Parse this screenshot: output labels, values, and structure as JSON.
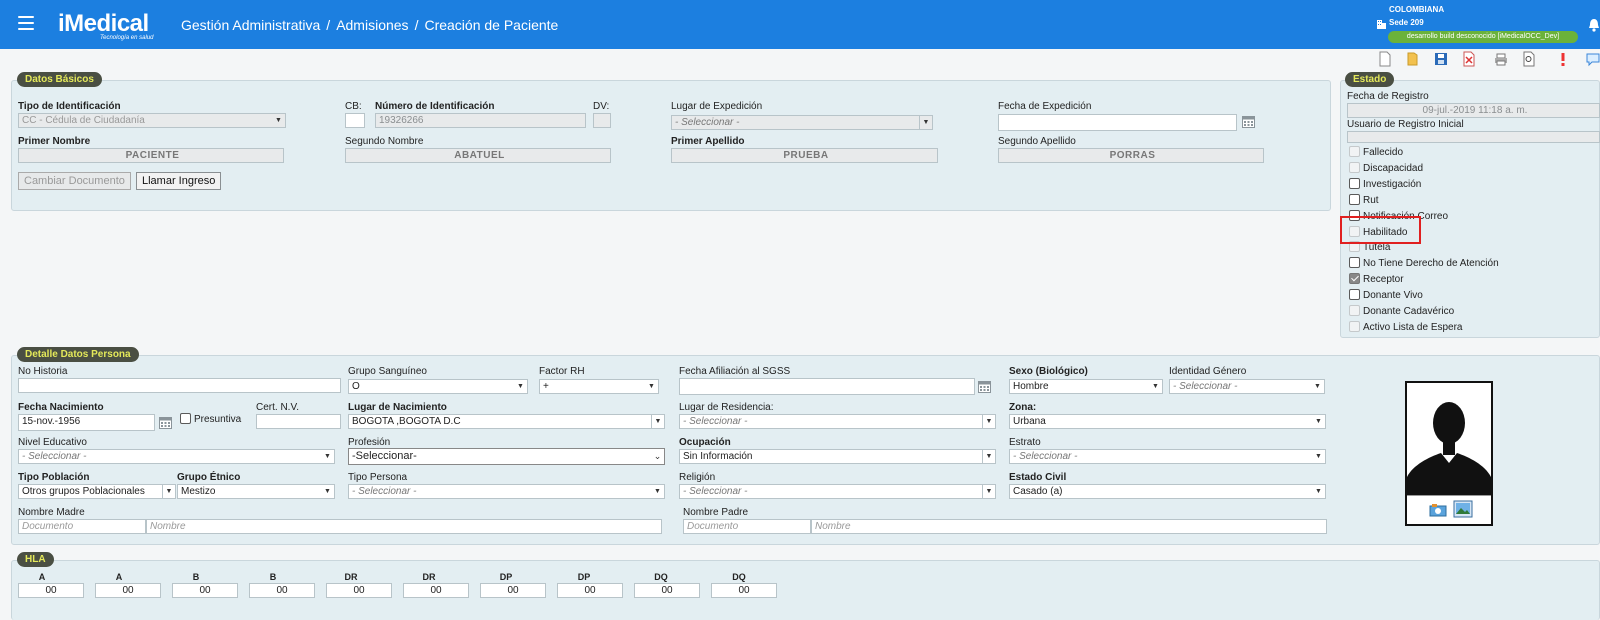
{
  "header": {
    "brand": "iMedical",
    "tagline": "Tecnología en salud",
    "breadcrumb": [
      "Gestión Administrativa",
      "Admisiones",
      "Creación de Paciente"
    ],
    "separator": "/",
    "organization": "COLOMBIANA",
    "sede": "Sede 209",
    "env_badge": "desarrollo build desconocido [iMedicalOCC_Dev]",
    "bg_color": "#1c7fe0"
  },
  "toolbar": {
    "icons": [
      "new-document-icon",
      "folder-icon",
      "save-icon",
      "delete-icon",
      "print-icon",
      "preview-icon",
      "alert-icon",
      "chat-icon"
    ]
  },
  "datos_basicos": {
    "legend": "Datos Básicos",
    "tipo_id_label": "Tipo de Identificación",
    "tipo_id_value": "CC - Cédula de Ciudadanía",
    "cb_label": "CB:",
    "num_id_label": "Número de Identificación",
    "num_id_value": "19326266",
    "dv_label": "DV:",
    "lugar_exp_label": "Lugar de Expedición",
    "lugar_exp_value": "- Seleccionar -",
    "fecha_exp_label": "Fecha de Expedición",
    "primer_nombre_label": "Primer Nombre",
    "primer_nombre_value": "PACIENTE",
    "segundo_nombre_label": "Segundo Nombre",
    "segundo_nombre_value": "ABATUEL",
    "primer_apellido_label": "Primer Apellido",
    "primer_apellido_value": "PRUEBA",
    "segundo_apellido_label": "Segundo Apellido",
    "segundo_apellido_value": "PORRAS",
    "btn_cambiar": "Cambiar Documento",
    "btn_llamar": "Llamar Ingreso"
  },
  "estado": {
    "legend": "Estado",
    "fecha_registro_label": "Fecha de Registro",
    "fecha_registro_value": "09-jul.-2019 11:18 a. m.",
    "usuario_label": "Usuario de Registro Inicial",
    "checks": [
      {
        "label": "Fallecido",
        "state": "disabled"
      },
      {
        "label": "Discapacidad",
        "state": "disabled"
      },
      {
        "label": "Investigación",
        "state": "unchecked"
      },
      {
        "label": "Rut",
        "state": "unchecked"
      },
      {
        "label": "Notificación Correo",
        "state": "unchecked"
      },
      {
        "label": "Habilitado",
        "state": "disabled"
      },
      {
        "label": "Tutela",
        "state": "disabled"
      },
      {
        "label": "No Tiene Derecho de Atención",
        "state": "unchecked"
      },
      {
        "label": "Receptor",
        "state": "checked"
      },
      {
        "label": "Donante Vivo",
        "state": "unchecked"
      },
      {
        "label": "Donante Cadavérico",
        "state": "disabled"
      },
      {
        "label": "Activo Lista de Espera",
        "state": "disabled"
      }
    ],
    "highlight_color": "#e02020"
  },
  "detalle": {
    "legend": "Detalle Datos Persona",
    "no_historia_label": "No Historia",
    "grupo_sang_label": "Grupo Sanguíneo",
    "grupo_sang_value": "O",
    "factor_rh_label": "Factor RH",
    "factor_rh_value": "+",
    "fecha_afil_label": "Fecha Afiliación al SGSS",
    "sexo_label": "Sexo (Biológico)",
    "sexo_value": "Hombre",
    "ident_genero_label": "Identidad Género",
    "ident_genero_value": "- Seleccionar -",
    "fecha_nac_label": "Fecha Nacimiento",
    "fecha_nac_value": "15-nov.-1956",
    "presuntiva_label": "Presuntiva",
    "cert_nv_label": "Cert. N.V.",
    "lugar_nac_label": "Lugar de Nacimiento",
    "lugar_nac_value": "BOGOTA ,BOGOTA D.C",
    "lugar_res_label": "Lugar de Residencia:",
    "lugar_res_value": "- Seleccionar -",
    "zona_label": "Zona:",
    "zona_value": "Urbana",
    "nivel_edu_label": "Nivel Educativo",
    "nivel_edu_value": "- Seleccionar -",
    "profesion_label": "Profesión",
    "profesion_value": "-Seleccionar-",
    "ocupacion_label": "Ocupación",
    "ocupacion_value": "Sin Información",
    "estrato_label": "Estrato",
    "estrato_value": "- Seleccionar -",
    "tipo_pob_label": "Tipo Población",
    "tipo_pob_value": "Otros grupos Poblacionales",
    "grupo_etnico_label": "Grupo Étnico",
    "grupo_etnico_value": "Mestizo",
    "tipo_persona_label": "Tipo Persona",
    "tipo_persona_value": "- Seleccionar -",
    "religion_label": "Religión",
    "religion_value": "- Seleccionar -",
    "estado_civil_label": "Estado Civil",
    "estado_civil_value": "Casado (a)",
    "nombre_madre_label": "Nombre Madre",
    "nombre_padre_label": "Nombre Padre",
    "doc_placeholder": "Documento",
    "nombre_placeholder": "Nombre"
  },
  "hla": {
    "legend": "HLA",
    "loci": [
      "A",
      "A",
      "B",
      "B",
      "DR",
      "DR",
      "DP",
      "DP",
      "DQ",
      "DQ"
    ],
    "values": [
      "00",
      "00",
      "00",
      "00",
      "00",
      "00",
      "00",
      "00",
      "00",
      "00"
    ]
  }
}
